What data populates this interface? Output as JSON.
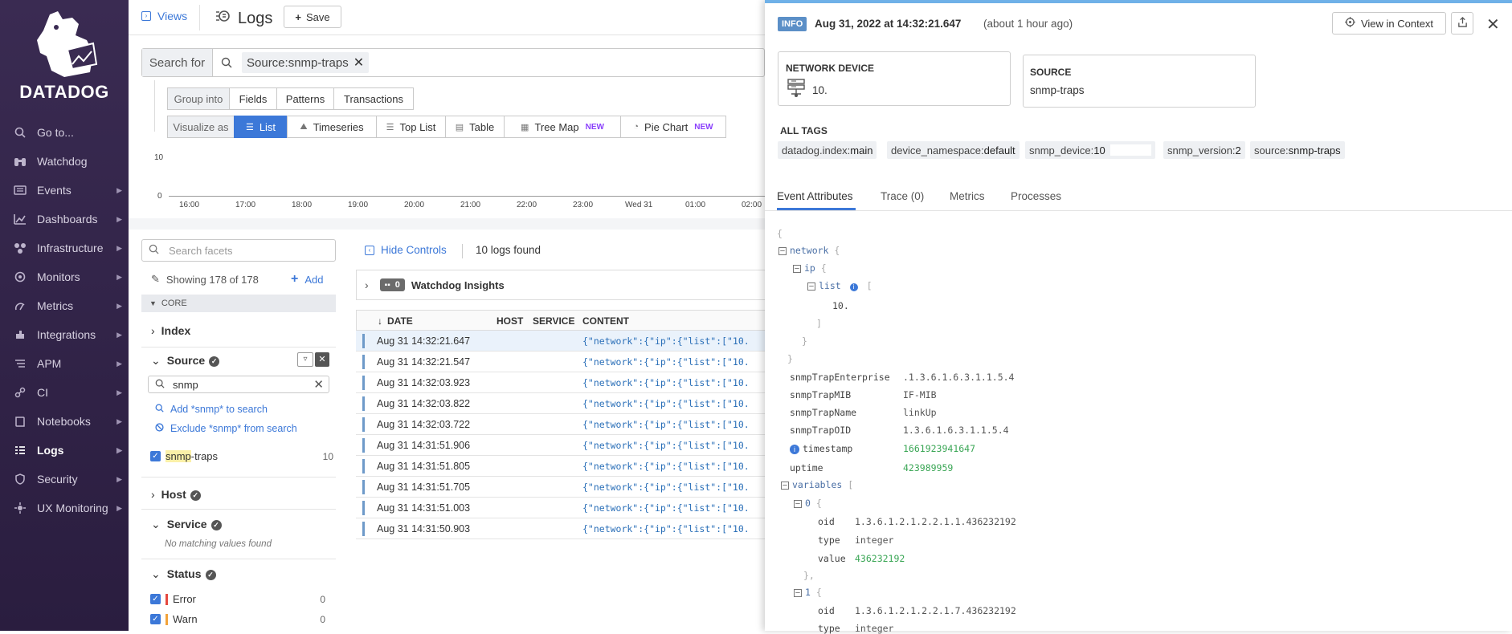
{
  "sidebar": {
    "brand": "DATADOG",
    "items": [
      {
        "label": "Go to...",
        "icon": "search-icon"
      },
      {
        "label": "Watchdog",
        "icon": "binoculars-icon"
      },
      {
        "label": "Events",
        "icon": "events-icon"
      },
      {
        "label": "Dashboards",
        "icon": "dashboards-icon"
      },
      {
        "label": "Infrastructure",
        "icon": "infrastructure-icon"
      },
      {
        "label": "Monitors",
        "icon": "monitors-icon"
      },
      {
        "label": "Metrics",
        "icon": "metrics-icon"
      },
      {
        "label": "Integrations",
        "icon": "integrations-icon"
      },
      {
        "label": "APM",
        "icon": "apm-icon"
      },
      {
        "label": "CI",
        "icon": "ci-icon"
      },
      {
        "label": "Notebooks",
        "icon": "notebooks-icon"
      },
      {
        "label": "Logs",
        "icon": "logs-icon"
      },
      {
        "label": "Security",
        "icon": "security-icon"
      },
      {
        "label": "UX Monitoring",
        "icon": "ux-monitoring-icon"
      }
    ]
  },
  "topbar": {
    "views": "Views",
    "title": "Logs",
    "save": "Save"
  },
  "search": {
    "label": "Search for",
    "chip": "Source:snmp-traps"
  },
  "group_into": {
    "label": "Group into",
    "options": [
      "Fields",
      "Patterns",
      "Transactions"
    ]
  },
  "visualize": {
    "label": "Visualize as",
    "options": [
      "List",
      "Timeseries",
      "Top List",
      "Table",
      "Tree Map",
      "Pie Chart"
    ],
    "new_badge": "NEW"
  },
  "timeseries": {
    "y_ticks": [
      "10",
      "0"
    ],
    "x_ticks": [
      "16:00",
      "17:00",
      "18:00",
      "19:00",
      "20:00",
      "21:00",
      "22:00",
      "23:00",
      "Wed 31",
      "01:00",
      "02:00"
    ]
  },
  "facets": {
    "search_placeholder": "Search facets",
    "showing": "Showing 178 of 178",
    "add": "Add",
    "core": "CORE",
    "index": "Index",
    "source": "Source",
    "source_query": "snmp",
    "add_to_search": "Add *snmp* to search",
    "exclude_from_search": "Exclude *snmp* from search",
    "source_value_highlight": "snmp",
    "source_value_rest": "-traps",
    "source_value_count": "10",
    "host": "Host",
    "service": "Service",
    "no_matching": "No matching values found",
    "status": "Status",
    "statuses": [
      {
        "label": "Error",
        "count": "0",
        "color": "#e5483f"
      },
      {
        "label": "Warn",
        "count": "0",
        "color": "#f2a33a"
      }
    ]
  },
  "list": {
    "hide_controls": "Hide Controls",
    "found": "10 logs found",
    "watchdog_count": "0",
    "watchdog_label": "Watchdog Insights",
    "columns": [
      "DATE",
      "HOST",
      "SERVICE",
      "CONTENT"
    ],
    "rows": [
      {
        "date": "Aug 31 14:32:21.647",
        "content": "{\"network\":{\"ip\":{\"list\":[\"10."
      },
      {
        "date": "Aug 31 14:32:21.547",
        "content": "{\"network\":{\"ip\":{\"list\":[\"10."
      },
      {
        "date": "Aug 31 14:32:03.923",
        "content": "{\"network\":{\"ip\":{\"list\":[\"10."
      },
      {
        "date": "Aug 31 14:32:03.822",
        "content": "{\"network\":{\"ip\":{\"list\":[\"10."
      },
      {
        "date": "Aug 31 14:32:03.722",
        "content": "{\"network\":{\"ip\":{\"list\":[\"10."
      },
      {
        "date": "Aug 31 14:31:51.906",
        "content": "{\"network\":{\"ip\":{\"list\":[\"10."
      },
      {
        "date": "Aug 31 14:31:51.805",
        "content": "{\"network\":{\"ip\":{\"list\":[\"10."
      },
      {
        "date": "Aug 31 14:31:51.705",
        "content": "{\"network\":{\"ip\":{\"list\":[\"10."
      },
      {
        "date": "Aug 31 14:31:51.003",
        "content": "{\"network\":{\"ip\":{\"list\":[\"10."
      },
      {
        "date": "Aug 31 14:31:50.903",
        "content": "{\"network\":{\"ip\":{\"list\":[\"10."
      }
    ]
  },
  "panel": {
    "level": "INFO",
    "timestamp": "Aug 31, 2022 at 14:32:21.647",
    "relative": "(about 1 hour ago)",
    "view_in_context": "View in Context",
    "network_device_label": "NETWORK DEVICE",
    "network_device_value": "10.",
    "source_label": "SOURCE",
    "source_value": "snmp-traps",
    "all_tags": "ALL TAGS",
    "tags": [
      {
        "key": "datadog.index:",
        "val": "main"
      },
      {
        "key": "device_namespace:",
        "val": "default"
      },
      {
        "key": "snmp_device:",
        "val": "10"
      },
      {
        "key": "snmp_version:",
        "val": "2"
      },
      {
        "key": "source:",
        "val": "snmp-traps"
      }
    ],
    "tabs": [
      "Event Attributes",
      "Trace (0)",
      "Metrics",
      "Processes"
    ],
    "json": {
      "network": "network",
      "ip": "ip",
      "list": "list",
      "ip_value": "10.",
      "fields": [
        {
          "k": "snmpTrapEnterprise",
          "v": ".1.3.6.1.6.3.1.1.5.4"
        },
        {
          "k": "snmpTrapMIB",
          "v": "IF-MIB"
        },
        {
          "k": "snmpTrapName",
          "v": "linkUp"
        },
        {
          "k": "snmpTrapOID",
          "v": "1.3.6.1.6.3.1.1.5.4"
        },
        {
          "k": "timestamp",
          "v": "1661923941647"
        },
        {
          "k": "uptime",
          "v": "423989959"
        }
      ],
      "variables": "variables",
      "var0": {
        "idx": "0",
        "oid": "1.3.6.1.2.1.2.2.1.1.436232192",
        "type": "integer",
        "value": "436232192"
      },
      "var1": {
        "idx": "1",
        "oid": "1.3.6.1.2.1.2.2.1.7.436232192",
        "type": "integer"
      },
      "oid_label": "oid",
      "type_label": "type",
      "value_label": "value"
    }
  }
}
